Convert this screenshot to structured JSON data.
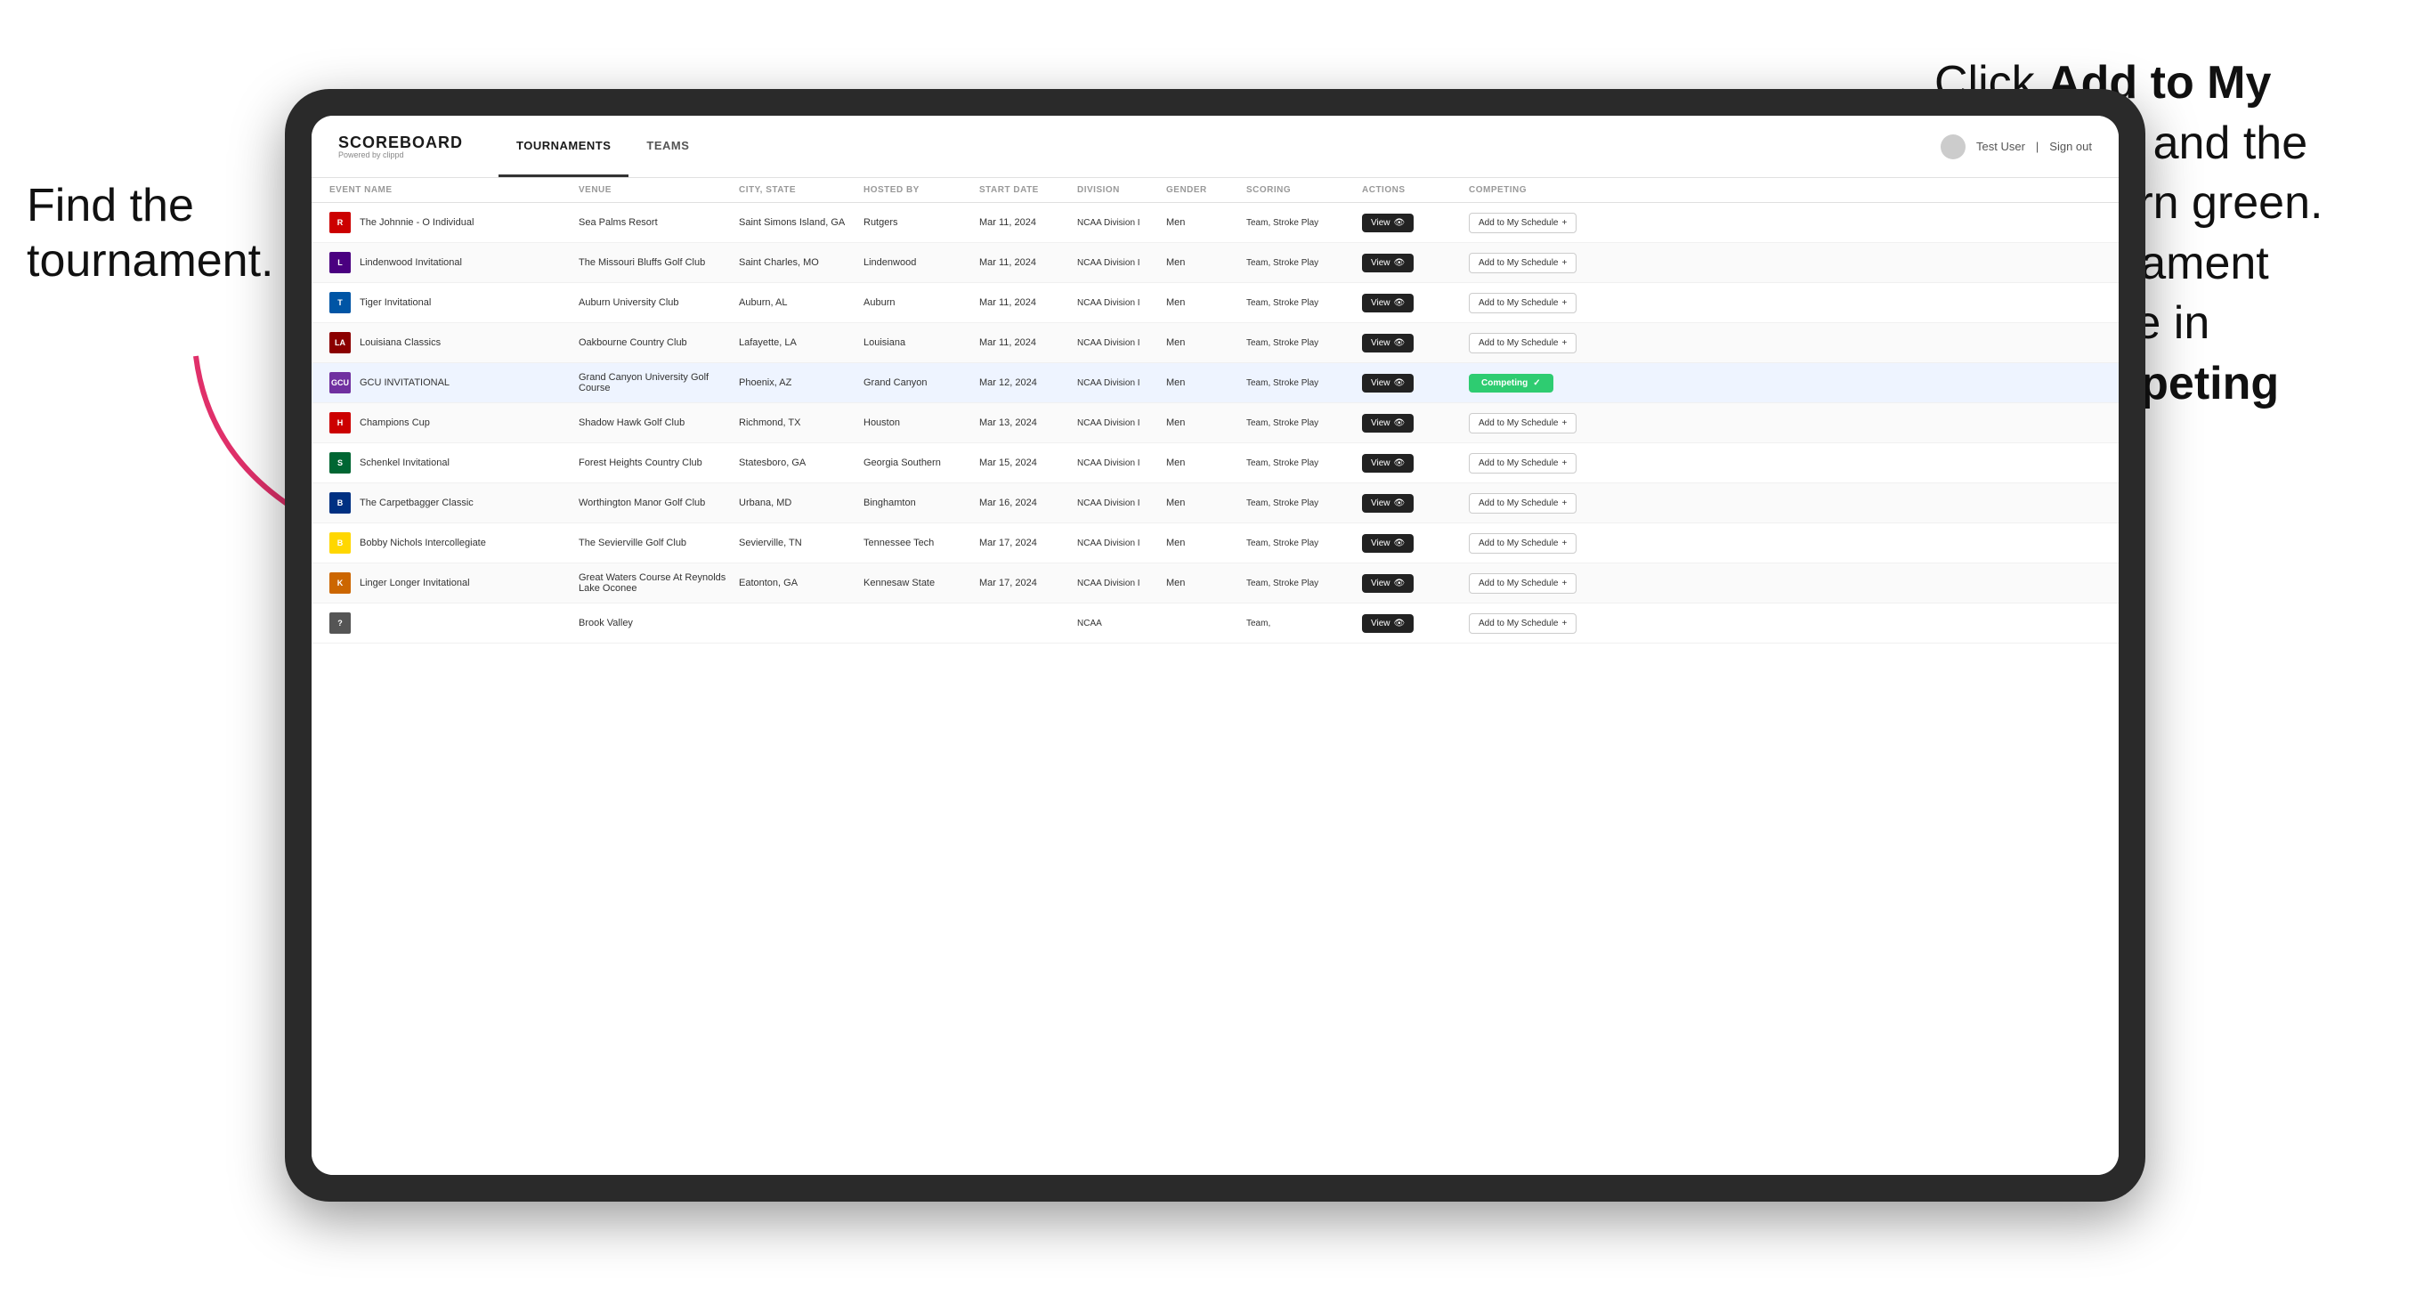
{
  "annotations": {
    "left_text_line1": "Find the",
    "left_text_line2": "tournament.",
    "right_text": "Click Add to My Schedule and the box will turn green. This tournament will now be in your Competing section."
  },
  "header": {
    "logo": "SCOREBOARD",
    "logo_sub": "Powered by clippd",
    "nav_tabs": [
      "TOURNAMENTS",
      "TEAMS"
    ],
    "active_tab": "TOURNAMENTS",
    "user_text": "Test User",
    "signout_text": "Sign out"
  },
  "table": {
    "columns": [
      "EVENT NAME",
      "VENUE",
      "CITY, STATE",
      "HOSTED BY",
      "START DATE",
      "DIVISION",
      "GENDER",
      "SCORING",
      "ACTIONS",
      "COMPETING"
    ],
    "rows": [
      {
        "logo_color": "#cc0000",
        "logo_letter": "R",
        "event_name": "The Johnnie - O Individual",
        "venue": "Sea Palms Resort",
        "city_state": "Saint Simons Island, GA",
        "hosted_by": "Rutgers",
        "start_date": "Mar 11, 2024",
        "division": "NCAA Division I",
        "gender": "Men",
        "scoring": "Team, Stroke Play",
        "status": "add",
        "highlighted": false
      },
      {
        "logo_color": "#4a0080",
        "logo_letter": "L",
        "event_name": "Lindenwood Invitational",
        "venue": "The Missouri Bluffs Golf Club",
        "city_state": "Saint Charles, MO",
        "hosted_by": "Lindenwood",
        "start_date": "Mar 11, 2024",
        "division": "NCAA Division I",
        "gender": "Men",
        "scoring": "Team, Stroke Play",
        "status": "add",
        "highlighted": false
      },
      {
        "logo_color": "#0055a5",
        "logo_letter": "T",
        "event_name": "Tiger Invitational",
        "venue": "Auburn University Club",
        "city_state": "Auburn, AL",
        "hosted_by": "Auburn",
        "start_date": "Mar 11, 2024",
        "division": "NCAA Division I",
        "gender": "Men",
        "scoring": "Team, Stroke Play",
        "status": "add",
        "highlighted": false
      },
      {
        "logo_color": "#8b0000",
        "logo_letter": "LA",
        "event_name": "Louisiana Classics",
        "venue": "Oakbourne Country Club",
        "city_state": "Lafayette, LA",
        "hosted_by": "Louisiana",
        "start_date": "Mar 11, 2024",
        "division": "NCAA Division I",
        "gender": "Men",
        "scoring": "Team, Stroke Play",
        "status": "add",
        "highlighted": false
      },
      {
        "logo_color": "#7030a0",
        "logo_letter": "GCU",
        "event_name": "GCU INVITATIONAL",
        "venue": "Grand Canyon University Golf Course",
        "city_state": "Phoenix, AZ",
        "hosted_by": "Grand Canyon",
        "start_date": "Mar 12, 2024",
        "division": "NCAA Division I",
        "gender": "Men",
        "scoring": "Team, Stroke Play",
        "status": "competing",
        "highlighted": true
      },
      {
        "logo_color": "#cc0000",
        "logo_letter": "H",
        "event_name": "Champions Cup",
        "venue": "Shadow Hawk Golf Club",
        "city_state": "Richmond, TX",
        "hosted_by": "Houston",
        "start_date": "Mar 13, 2024",
        "division": "NCAA Division I",
        "gender": "Men",
        "scoring": "Team, Stroke Play",
        "status": "add",
        "highlighted": false
      },
      {
        "logo_color": "#006633",
        "logo_letter": "S",
        "event_name": "Schenkel Invitational",
        "venue": "Forest Heights Country Club",
        "city_state": "Statesboro, GA",
        "hosted_by": "Georgia Southern",
        "start_date": "Mar 15, 2024",
        "division": "NCAA Division I",
        "gender": "Men",
        "scoring": "Team, Stroke Play",
        "status": "add",
        "highlighted": false
      },
      {
        "logo_color": "#003082",
        "logo_letter": "B",
        "event_name": "The Carpetbagger Classic",
        "venue": "Worthington Manor Golf Club",
        "city_state": "Urbana, MD",
        "hosted_by": "Binghamton",
        "start_date": "Mar 16, 2024",
        "division": "NCAA Division I",
        "gender": "Men",
        "scoring": "Team, Stroke Play",
        "status": "add",
        "highlighted": false
      },
      {
        "logo_color": "#ffd700",
        "logo_letter": "B",
        "event_name": "Bobby Nichols Intercollegiate",
        "venue": "The Sevierville Golf Club",
        "city_state": "Sevierville, TN",
        "hosted_by": "Tennessee Tech",
        "start_date": "Mar 17, 2024",
        "division": "NCAA Division I",
        "gender": "Men",
        "scoring": "Team, Stroke Play",
        "status": "add",
        "highlighted": false
      },
      {
        "logo_color": "#cc6600",
        "logo_letter": "K",
        "event_name": "Linger Longer Invitational",
        "venue": "Great Waters Course At Reynolds Lake Oconee",
        "city_state": "Eatonton, GA",
        "hosted_by": "Kennesaw State",
        "start_date": "Mar 17, 2024",
        "division": "NCAA Division I",
        "gender": "Men",
        "scoring": "Team, Stroke Play",
        "status": "add",
        "highlighted": false
      },
      {
        "logo_color": "#555",
        "logo_letter": "?",
        "event_name": "",
        "venue": "Brook Valley",
        "city_state": "",
        "hosted_by": "",
        "start_date": "",
        "division": "NCAA",
        "gender": "",
        "scoring": "Team,",
        "status": "add",
        "highlighted": false
      }
    ]
  },
  "buttons": {
    "view_label": "View",
    "add_label": "Add to My Schedule",
    "competing_label": "Competing"
  }
}
